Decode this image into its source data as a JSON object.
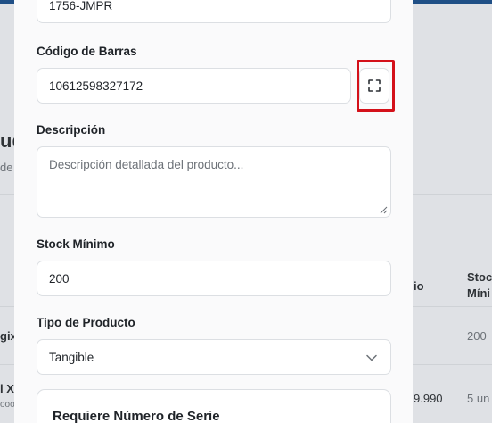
{
  "background": {
    "heading_fragment": "ud",
    "heading_subfragment": "de",
    "table": {
      "col_price_fragment": "io",
      "col_stock_line1": "Stoc",
      "col_stock_line2": "Míni",
      "row1_name_fragment": "gix",
      "row1_stock": "200",
      "row2_name_fragment": "l X",
      "row2_name_sub": "ooo",
      "row2_price": "9.990",
      "row2_stock": "5 un"
    }
  },
  "form": {
    "sku_value": "1756-JMPR",
    "barcode": {
      "label": "Código de Barras",
      "value": "10612598327172",
      "scan_icon": "scan-icon"
    },
    "description": {
      "label": "Descripción",
      "placeholder": "Descripción detallada del producto..."
    },
    "min_stock": {
      "label": "Stock Mínimo",
      "value": "200"
    },
    "product_type": {
      "label": "Tipo de Producto",
      "selected": "Tangible"
    },
    "serial_card": {
      "title": "Requiere Número de Serie"
    }
  },
  "colors": {
    "highlight": "#d4111a",
    "topbar": "#1f4f86"
  }
}
